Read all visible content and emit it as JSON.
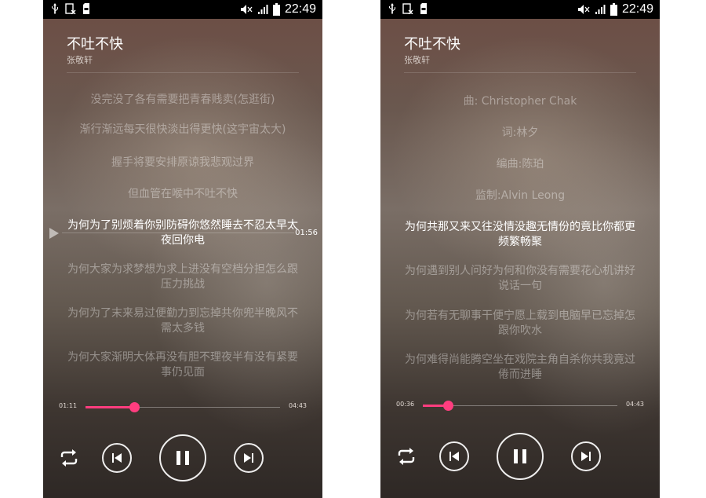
{
  "status_bar": {
    "time": "22:49",
    "icons": [
      "usb-icon",
      "sim-icon",
      "storage-icon",
      "mute-icon",
      "signal-icon",
      "battery-icon"
    ]
  },
  "screens": [
    {
      "title": "不吐不快",
      "artist": "张敬轩",
      "lyrics": [
        "没完没了各有需要把青春贱卖(怎逛街)",
        "渐行渐远每天很快淡出得更快(这宇宙太大)",
        "握手将要安排原谅我悲观过界",
        "但血管在喉中不吐不快",
        "为何为了别烦着你别防碍你悠然睡去不忍太早太夜回你电",
        "为何大家为求梦想为求上进没有空档分担怎么跟压力挑战",
        "为何为了末来易过便勤力到忘掉共你兜半晚风不需太多钱",
        "为何大家渐明大体再没有胆不理夜半有没有紧要事仍见面"
      ],
      "active_lyric": 4,
      "seek_marker_time": "01:56",
      "progress": {
        "current": "01:11",
        "total": "04:43",
        "fraction": 0.25
      },
      "state": "playing"
    },
    {
      "title": "不吐不快",
      "artist": "张敬轩",
      "lyrics": [
        "曲: Christopher Chak",
        "词:林夕",
        "编曲:陈珀",
        "监制:Alvin Leong",
        "为何共那又来又往没情没趣无情份的竟比你都更频繁畅聚",
        "为何遇到别人问好为何和你没有需要花心机讲好说话一句",
        "为何若有无聊事干便宁愿上载到电脑早已忘掉怎跟你吹水",
        "为何难得尚能腾空坐在戏院主角自杀你共我竟过倦而进睡"
      ],
      "active_lyric": 4,
      "progress": {
        "current": "00:36",
        "total": "04:43",
        "fraction": 0.13
      },
      "state": "playing"
    }
  ],
  "colors": {
    "accent": "#ff3d7f",
    "text_primary": "#ffffff",
    "statusbar": "#000000"
  }
}
